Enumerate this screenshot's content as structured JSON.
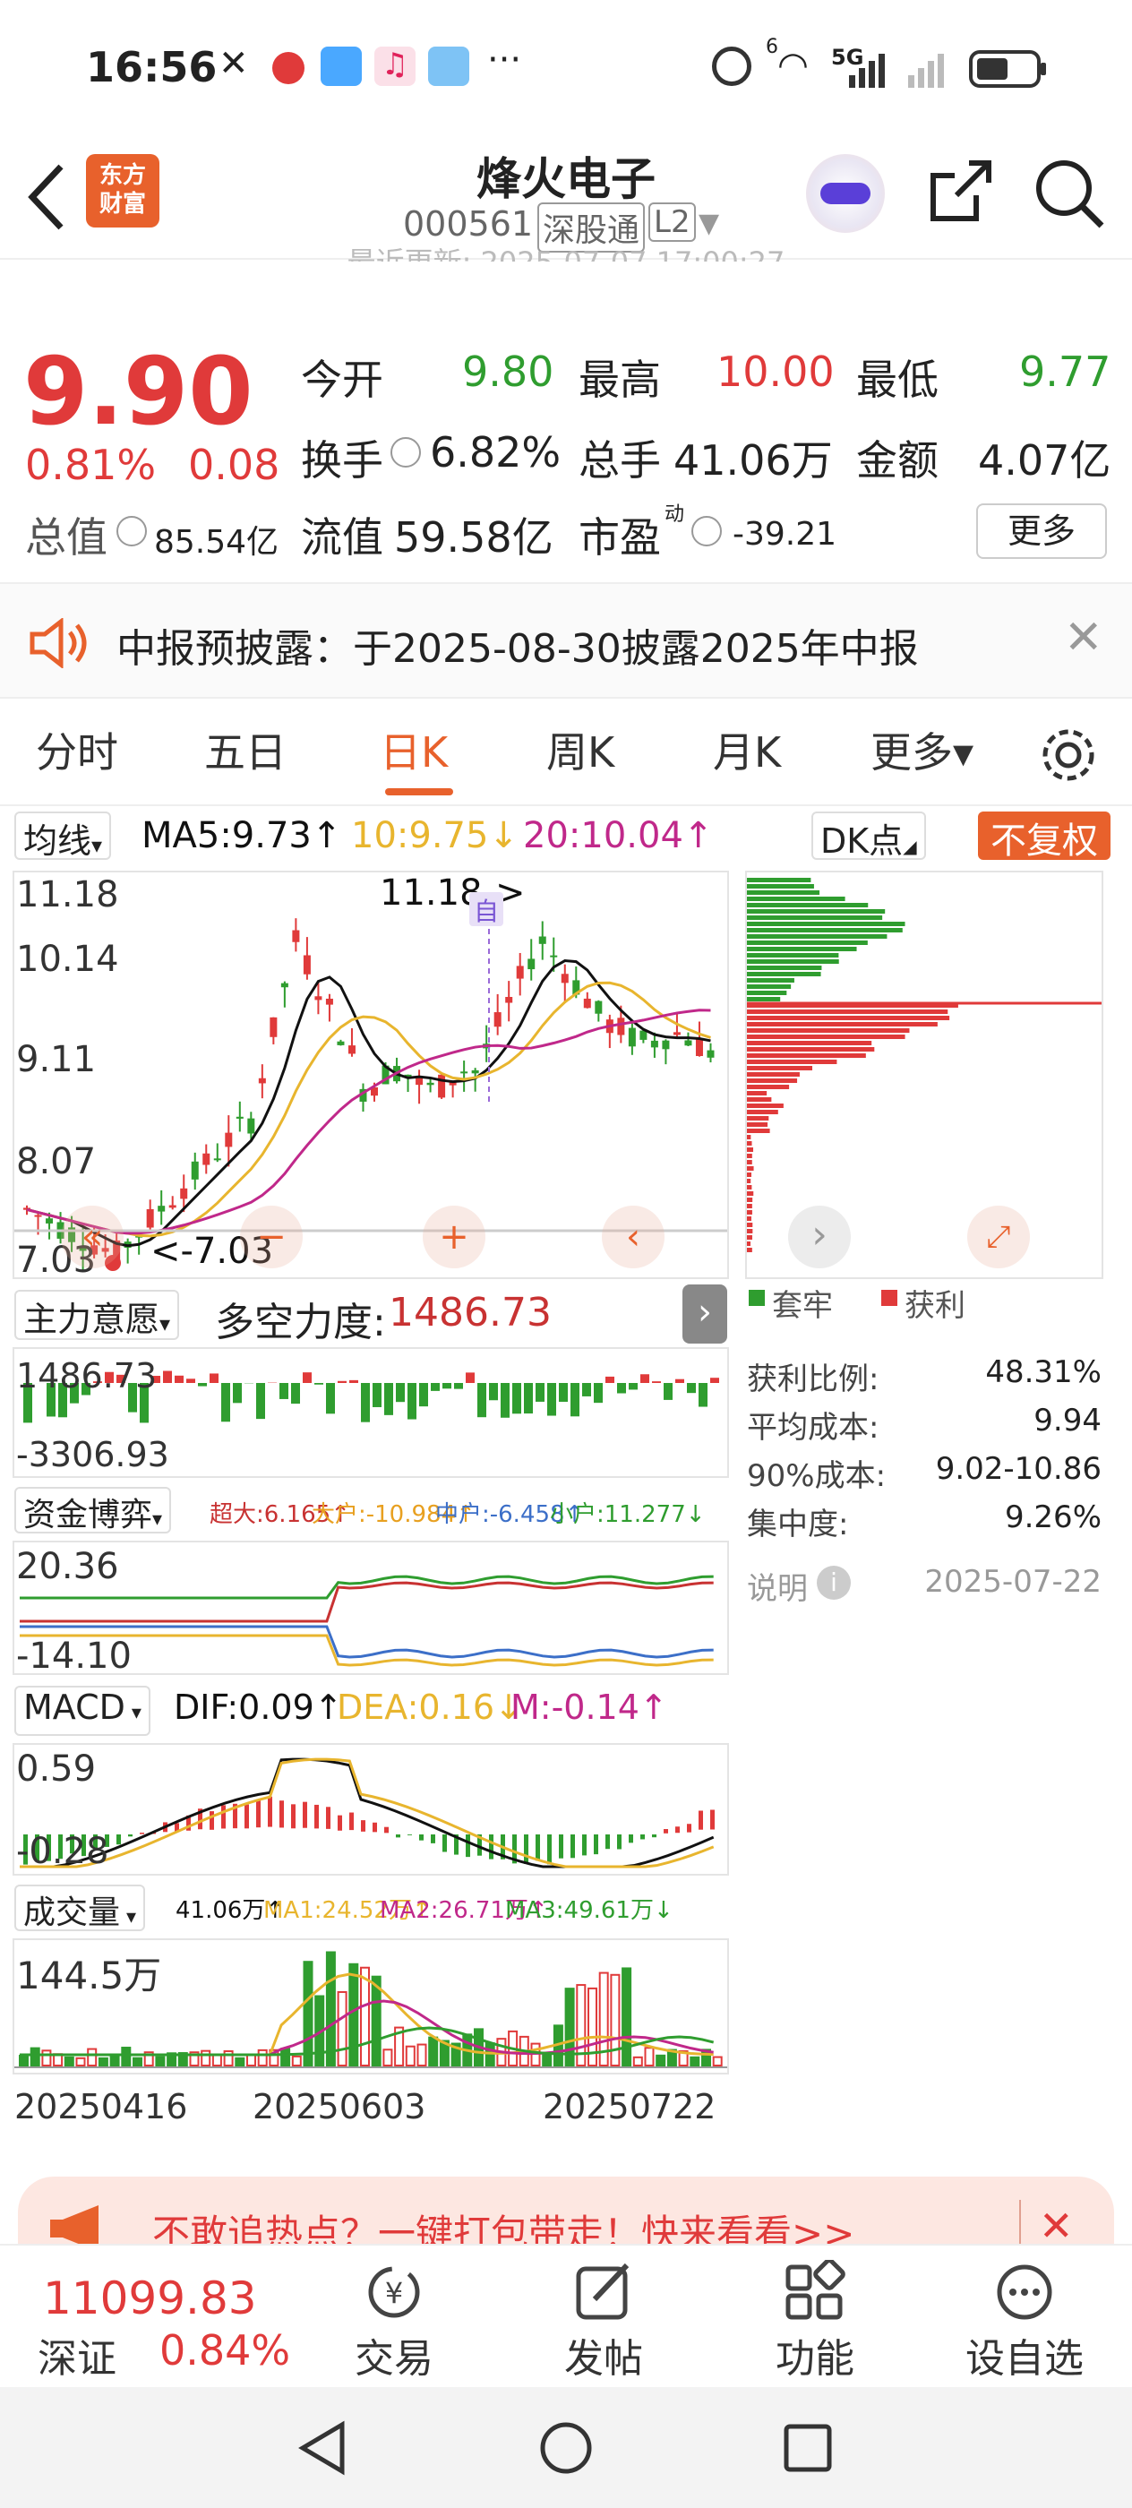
{
  "status": {
    "time": "16:56",
    "net_label": "5G",
    "wifi_label": "6"
  },
  "header": {
    "title": "烽火电子",
    "code": "000561",
    "market_tag": "深股通",
    "level_tag": "L2",
    "logo_text": "东方\n财富",
    "subtitle_faded": "最近更新: 2025-07-07 17:00:27"
  },
  "quote": {
    "price": "9.90",
    "change_pct": "0.81%",
    "change": "0.08",
    "open_label": "今开",
    "open": "9.80",
    "high_label": "最高",
    "high": "10.00",
    "low_label": "最低",
    "low": "9.77",
    "turnover_label": "换手",
    "turnover": "6.82%",
    "volume_label": "总手",
    "volume": "41.06万",
    "amount_label": "金额",
    "amount": "4.07亿",
    "mktcap_label": "总值",
    "mktcap": "85.54亿",
    "float_label": "流值",
    "float": "59.58亿",
    "pe_label": "市盈",
    "pe_sup": "动",
    "pe": "-39.21",
    "more_button": "更多"
  },
  "notice": {
    "text": "中报预披露：于2025-08-30披露2025年中报"
  },
  "tabs": [
    {
      "label": "分时"
    },
    {
      "label": "五日"
    },
    {
      "label": "日K",
      "active": true
    },
    {
      "label": "周K"
    },
    {
      "label": "月K"
    },
    {
      "label": "更多▾"
    }
  ],
  "kline": {
    "ma_select": "均线",
    "ma5": "MA5:9.73↑",
    "ma10": "10:9.75↓",
    "ma20": "20:10.04↑",
    "dk_select": "DK点",
    "fq_button": "不复权",
    "y_ticks": [
      "11.18",
      "10.14",
      "9.11",
      "8.07",
      "7.03"
    ],
    "high_marker": "11.18->",
    "low_marker": "<-7.03",
    "self_mark": "自"
  },
  "chip": {
    "legend_trapped": "套牢",
    "legend_profit": "获利",
    "rows": [
      {
        "label": "获利比例:",
        "value": "48.31%"
      },
      {
        "label": "平均成本:",
        "value": "9.94"
      },
      {
        "label": "90%成本:",
        "value": "9.02-10.86"
      },
      {
        "label": "集中度:",
        "value": "9.26%"
      }
    ],
    "note_label": "说明",
    "date": "2025-07-22"
  },
  "force": {
    "select": "主力意愿",
    "label": "多空力度:",
    "value": "1486.73",
    "y_ticks": [
      "1486.73",
      "-3306.93"
    ]
  },
  "funds": {
    "select": "资金博弈",
    "super": "超大:6.165↑",
    "large": "大户:-10.984↑",
    "mid": "中户:-6.458↑",
    "small": "小户:11.277↓",
    "y_ticks": [
      "20.36",
      "-14.10"
    ]
  },
  "macd": {
    "select": "MACD",
    "dif": "DIF:0.09↑",
    "dea": "DEA:0.16↓",
    "m": "M:-0.14↑",
    "y_ticks": [
      "0.59",
      "-0.28"
    ]
  },
  "volume": {
    "select": "成交量",
    "vol": "41.06万↑",
    "ma1": "MA1:24.52万↑",
    "ma2": "MA2:26.71万↑",
    "ma3": "MA3:49.61万↓",
    "y_tick": "144.5万",
    "dates": [
      "20250416",
      "20250603",
      "20250722"
    ]
  },
  "ad": {
    "text": "不敢追热点？一键打包带走！快来看看>>"
  },
  "bottom": {
    "index_value": "11099.83",
    "index_name": "深证",
    "index_pct": "0.84%",
    "items": [
      {
        "label": "交易"
      },
      {
        "label": "发帖"
      },
      {
        "label": "功能"
      },
      {
        "label": "设自选"
      }
    ]
  },
  "colors": {
    "up": "#e03a3a",
    "down": "#2f9d2f",
    "accent": "#e8612c",
    "ma10": "#e8b52e",
    "ma20": "#c0288a"
  }
}
